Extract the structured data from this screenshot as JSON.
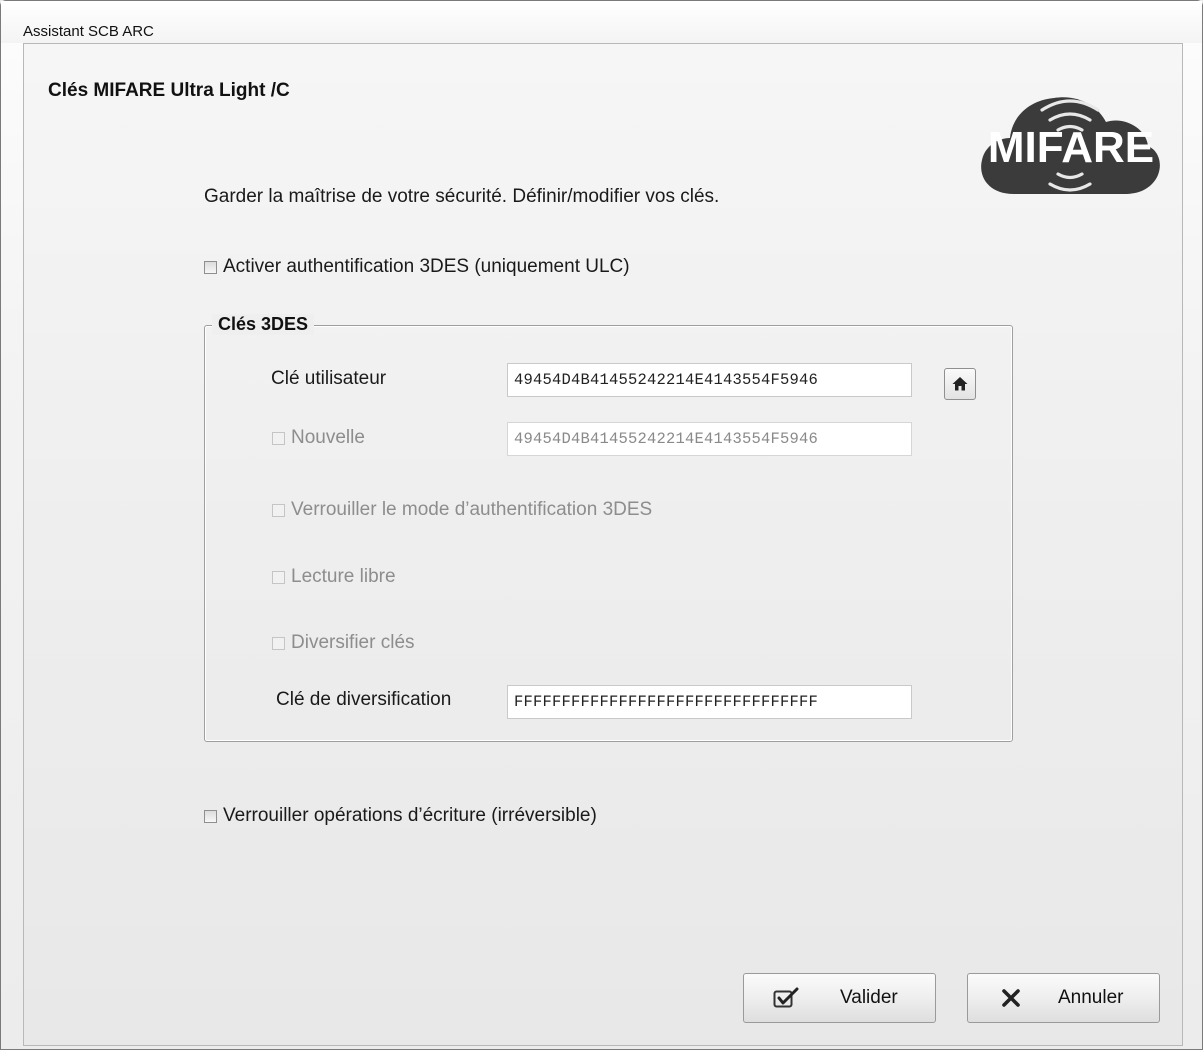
{
  "window": {
    "title": "Assistant SCB ARC"
  },
  "page": {
    "title": "Clés MIFARE Ultra Light /C",
    "description": "Garder la maîtrise de votre sécurité. Définir/modifier vos clés.",
    "logo_text": "MIFARE"
  },
  "options": {
    "activate_3des_label": "Activer authentification 3DES (uniquement ULC)",
    "activate_3des_checked": false,
    "lock_write_label": "Verrouiller opérations d’écriture (irréversible)",
    "lock_write_checked": false
  },
  "keys_group": {
    "legend": "Clés 3DES",
    "user_key_label": "Clé utilisateur",
    "user_key_value": "49454D4B41455242214E4143554F5946",
    "new_label": "Nouvelle",
    "new_key_value": "49454D4B41455242214E4143554F5946",
    "lock_auth_label": "Verrouiller le mode d’authentification 3DES",
    "free_read_label": "Lecture libre",
    "diversify_label": "Diversifier clés",
    "diversification_key_label": "Clé de diversification",
    "diversification_key_value": "FFFFFFFFFFFFFFFFFFFFFFFFFFFFFFFF",
    "home_icon": "home-icon"
  },
  "buttons": {
    "validate_label": "Valider",
    "cancel_label": "Annuler"
  }
}
